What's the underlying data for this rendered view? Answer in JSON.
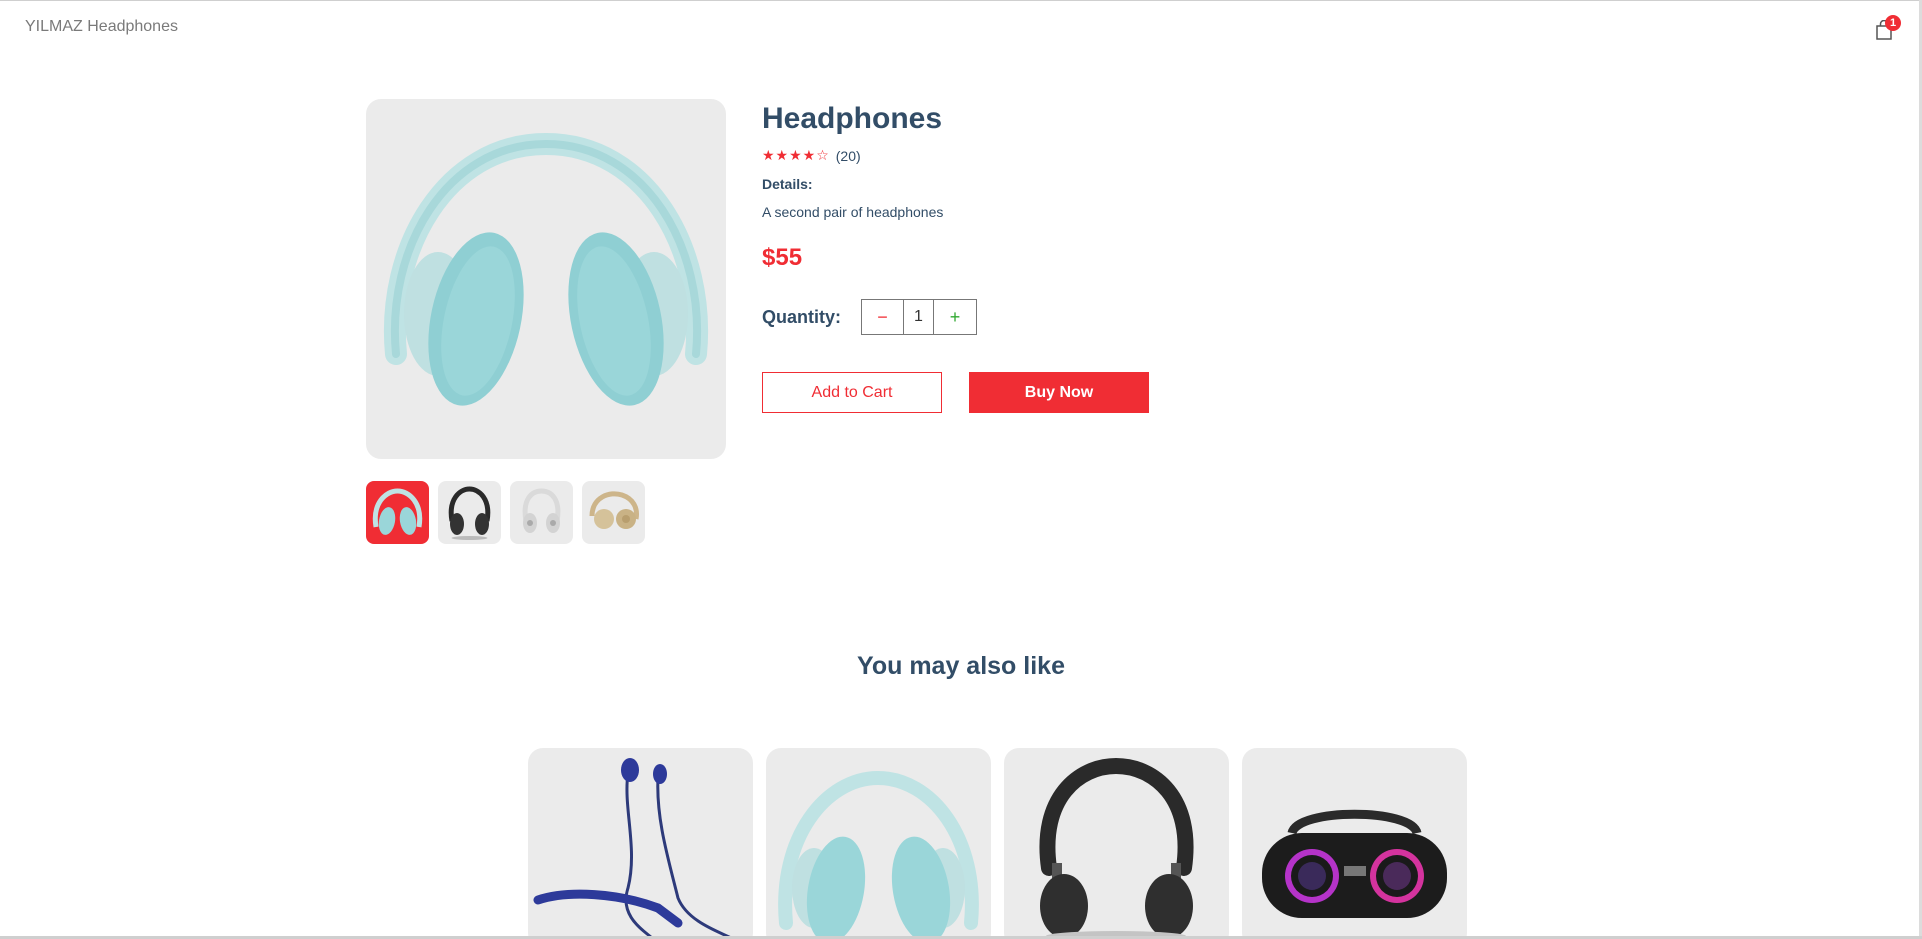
{
  "navbar": {
    "logo": "YILMAZ Headphones",
    "cart_count": "1"
  },
  "product": {
    "title": "Headphones",
    "stars": "★★★★☆",
    "review_count": "(20)",
    "details_label": "Details:",
    "details_text": "A second pair of headphones",
    "price": "$55",
    "quantity_label": "Quantity:",
    "quantity": "1",
    "minus": "−",
    "plus": "+",
    "add_to_cart": "Add to Cart",
    "buy_now": "Buy Now"
  },
  "colors": {
    "accent": "#f02d34",
    "text": "#324d67",
    "card_bg": "#ebebeb"
  },
  "thumbnails": [
    {
      "name": "mint-headphones",
      "selected": true
    },
    {
      "name": "black-headphones",
      "selected": false
    },
    {
      "name": "white-headphones",
      "selected": false
    },
    {
      "name": "beige-headphones",
      "selected": false
    }
  ],
  "related": {
    "title": "You may also like",
    "items": [
      "blue-neckband-earphones",
      "mint-headphones",
      "black-headphones",
      "black-boombox-speaker"
    ]
  }
}
